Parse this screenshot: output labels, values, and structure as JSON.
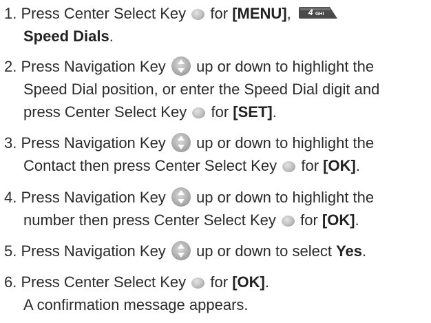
{
  "steps": [
    {
      "num": "1.",
      "t1": "Press Center Select Key",
      "t2": "for",
      "b1": "[MENU]",
      "t3": ",",
      "key": "4",
      "keyLetters": "GHI",
      "b2": "Speed Dials",
      "t4": "."
    },
    {
      "num": "2.",
      "t1": "Press Navigation Key",
      "t2": "up or down to highlight the",
      "l2": "Speed Dial position, or enter the Speed Dial digit and",
      "l3a": "press Center Select Key",
      "l3b": "for",
      "b1": "[SET]",
      "l3c": "."
    },
    {
      "num": "3.",
      "t1": "Press Navigation Key",
      "t2": "up or down to highlight the",
      "l2a": "Contact then press Center Select Key",
      "l2b": "for",
      "b1": "[OK]",
      "l2c": "."
    },
    {
      "num": "4.",
      "t1": "Press Navigation Key",
      "t2": "up or down to highlight the",
      "l2a": "number then press Center Select Key",
      "l2b": "for",
      "b1": "[OK]",
      "l2c": "."
    },
    {
      "num": "5.",
      "t1": "Press Navigation Key",
      "t2": "up or down to select",
      "b1": "Yes",
      "t3": "."
    },
    {
      "num": "6.",
      "t1": "Press Center Select Key",
      "t2": "for",
      "b1": "[OK]",
      "t3": ".",
      "l2": "A confirmation message appears."
    }
  ]
}
